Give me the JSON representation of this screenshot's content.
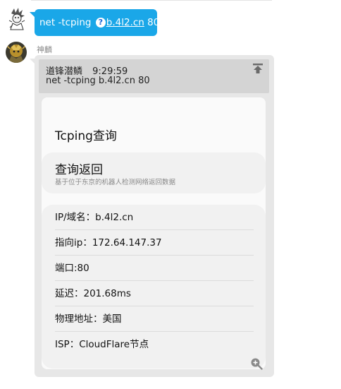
{
  "user_message": {
    "command": "net -tcping",
    "host": "b.4l2.cn",
    "port": "80"
  },
  "bot_message": {
    "sender": "神麟",
    "quote": {
      "author": "道锋潜鳞",
      "time": "9:29:59",
      "text": "net -tcping b.4l2.cn 80"
    },
    "card": {
      "title": "Tcping查询",
      "section_title": "查询返回",
      "section_subtitle": "基于位于东京的机器人检测网络返回数据",
      "rows": [
        "IP/域名：b.4l2.cn",
        "指向ip：172.64.147.37",
        "端口:80",
        "延迟：201.68ms",
        "物理地址：美国",
        "ISP：CloudFlare节点"
      ]
    }
  },
  "icons": {
    "help": "question-circle-icon",
    "pin": "pin-to-top-icon",
    "zoom": "zoom-in-icon"
  },
  "colors": {
    "user_bubble": "#1aa7e8",
    "bot_bubble": "#e7e7e7"
  }
}
